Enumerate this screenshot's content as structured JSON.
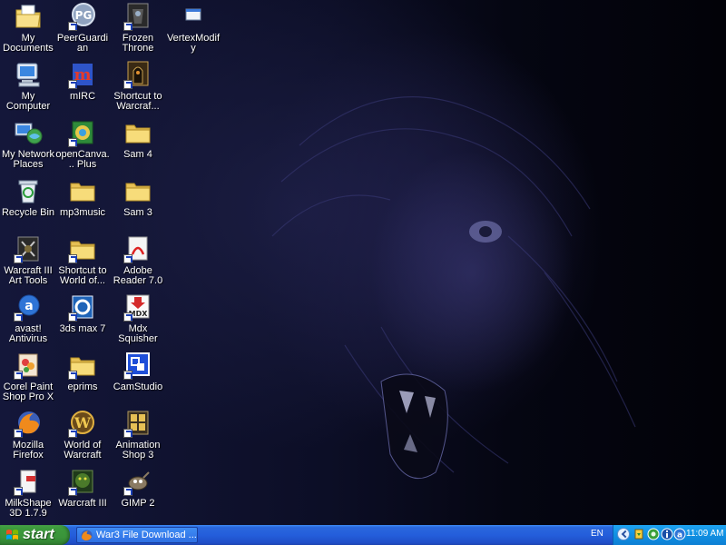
{
  "desktop": {
    "icons": [
      {
        "label": "My Documents"
      },
      {
        "label": "My Computer"
      },
      {
        "label": "My Network Places"
      },
      {
        "label": "Recycle Bin"
      },
      {
        "label": "Warcraft III Art Tools"
      },
      {
        "label": "avast! Antivirus"
      },
      {
        "label": "Corel Paint Shop Pro X"
      },
      {
        "label": "Mozilla Firefox"
      },
      {
        "label": "MilkShape 3D 1.7.9"
      },
      {
        "label": "PeerGuardian",
        "badge": "PG"
      },
      {
        "label": "mIRC",
        "badge": "m"
      },
      {
        "label": "openCanva... Plus"
      },
      {
        "label": "mp3music"
      },
      {
        "label": "Shortcut to World of..."
      },
      {
        "label": "3ds max 7"
      },
      {
        "label": "eprims"
      },
      {
        "label": "World of Warcraft"
      },
      {
        "label": "Warcraft III"
      },
      {
        "label": "Frozen Throne"
      },
      {
        "label": "Shortcut to Warcraf..."
      },
      {
        "label": "Sam 4"
      },
      {
        "label": "Sam 3"
      },
      {
        "label": "Adobe Reader 7.0"
      },
      {
        "label": "Mdx Squisher",
        "badge": "MDX"
      },
      {
        "label": "CamStudio"
      },
      {
        "label": "Animation Shop 3"
      },
      {
        "label": "GIMP 2"
      },
      {
        "label": "VertexModify"
      }
    ]
  },
  "taskbar": {
    "start_label": "start",
    "task_label": "War3 File Download ...",
    "language": "EN",
    "clock": "11:09 AM"
  },
  "colors": {
    "folder": "#f5d76e",
    "taskbar": "#245edb",
    "start": "#3c9a3c",
    "tray": "#1190e2"
  }
}
